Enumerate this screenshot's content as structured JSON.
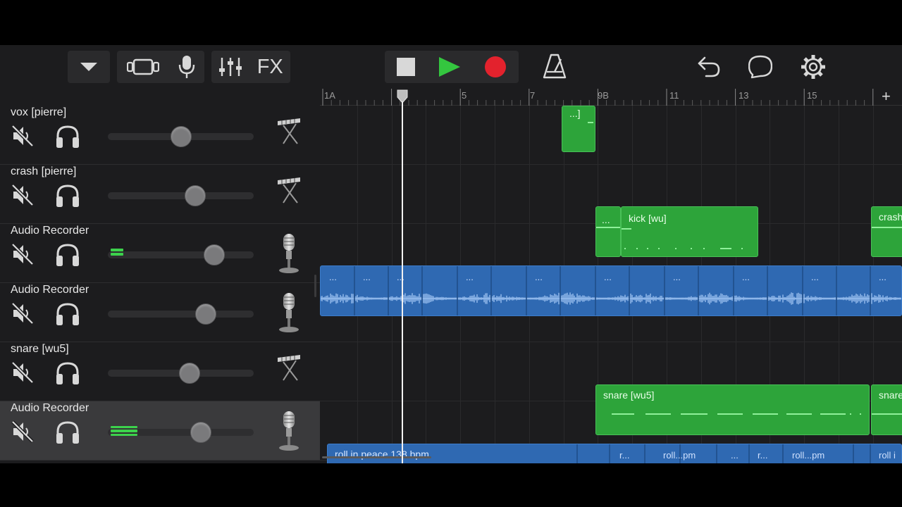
{
  "toolbar": {
    "fx_label": "FX",
    "icons": [
      "dropdown-arrow-icon",
      "browser-view-icon",
      "microphone-icon",
      "mixer-icon",
      "stop-icon",
      "play-icon",
      "record-icon",
      "metronome-icon",
      "undo-icon",
      "loop-icon",
      "settings-icon"
    ],
    "colors": {
      "play": "#34c63f",
      "record": "#e3222d"
    }
  },
  "ruler": {
    "markers": [
      {
        "label": "1A",
        "bar": 1
      },
      {
        "label": "5",
        "bar": 5
      },
      {
        "label": "7",
        "bar": 7
      },
      {
        "label": "9B",
        "bar": 9
      },
      {
        "label": "11",
        "bar": 11
      },
      {
        "label": "13",
        "bar": 13
      },
      {
        "label": "15",
        "bar": 15
      }
    ],
    "add_label": "+"
  },
  "tracks": [
    {
      "name": "vox [pierre]",
      "volume": 0.5,
      "instrument": "synth-keyboard-icon",
      "level": 0
    },
    {
      "name": "crash [pierre]",
      "volume": 0.6,
      "instrument": "synth-keyboard-icon",
      "level": 0
    },
    {
      "name": "Audio Recorder",
      "volume": 0.73,
      "instrument": "microphone-icon",
      "level": 1
    },
    {
      "name": "Audio Recorder",
      "volume": 0.67,
      "instrument": "microphone-icon",
      "level": 0
    },
    {
      "name": "snare [wu5]",
      "volume": 0.56,
      "instrument": "synth-keyboard-icon",
      "level": 0
    },
    {
      "name": "Audio Recorder",
      "volume": 0.64,
      "instrument": "microphone-icon",
      "level": 2,
      "selected": true
    }
  ],
  "regions": {
    "vox_small": "...]",
    "crash_small": "...",
    "kick": "kick [wu]",
    "crash_edge": "crash",
    "audio_dots": "...",
    "snare": "snare [wu5]",
    "snare_edge": "snare",
    "roll_main": "roll in peace 138 bpm",
    "roll_r1": "r...",
    "roll_pm1": "roll...pm",
    "roll_dots": "...",
    "roll_r2": "r...",
    "roll_pm2": "roll...pm",
    "roll_edge": "roll i"
  }
}
